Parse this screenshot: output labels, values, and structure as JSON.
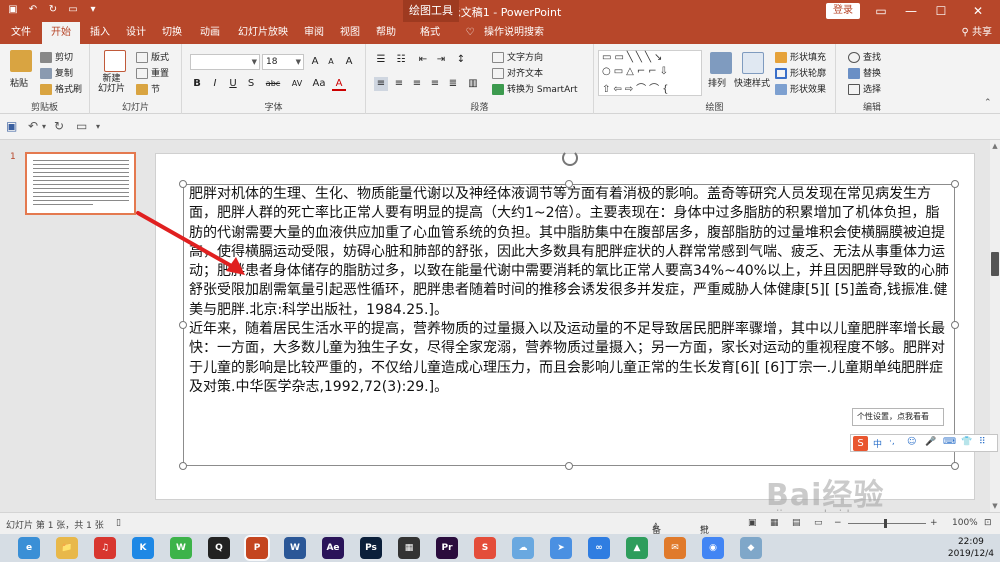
{
  "window": {
    "title": "演示文稿1 - PowerPoint",
    "contextual_tab_group": "绘图工具",
    "login_button": "登录",
    "controls": [
      "—",
      "☐",
      "✕"
    ]
  },
  "tabs": [
    "文件",
    "开始",
    "插入",
    "设计",
    "切换",
    "动画",
    "幻灯片放映",
    "审阅",
    "视图",
    "帮助",
    "格式"
  ],
  "tell_me": "操作说明搜索",
  "share": "共享",
  "ribbon": {
    "clipboard": {
      "label": "剪贴板",
      "paste": "粘贴",
      "cut": "剪切",
      "copy": "复制",
      "format_painter": "格式刷"
    },
    "slides": {
      "label": "幻灯片",
      "new_slide": "新建\n幻灯片",
      "layout": "版式",
      "reset": "重置",
      "section": "节"
    },
    "font": {
      "label": "字体",
      "font_name": "",
      "font_size": "18",
      "bold": "B",
      "italic": "I",
      "underline": "U",
      "strike": "S",
      "shadow": "abc",
      "spacing": "AV",
      "case": "Aa",
      "color": "A"
    },
    "paragraph": {
      "label": "段落",
      "text_direction": "文字方向",
      "align_text": "对齐文本",
      "smartart": "转换为 SmartArt"
    },
    "drawing": {
      "label": "绘图",
      "arrange": "排列",
      "quick_styles": "快速样式",
      "shape_fill": "形状填充",
      "shape_outline": "形状轮廓",
      "shape_effects": "形状效果"
    },
    "editing": {
      "label": "编辑",
      "find": "查找",
      "replace": "替换",
      "select": "选择"
    }
  },
  "thumbnail": {
    "number": "1"
  },
  "slide_text": "肥胖对机体的生理、生化、物质能量代谢以及神经体液调节等方面有着消极的影响。盖奇等研究人员发现在常见病发生方面，肥胖人群的死亡率比正常人要有明显的提高（大约1~2倍）。主要表现在：身体中过多脂肪的积累增加了机体负担，脂肪的代谢需要大量的血液供应加重了心血管系统的负担。其中脂肪集中在腹部居多，腹部脂肪的过量堆积会使横膈膜被迫提高，使得横膈运动受限，妨碍心脏和肺部的舒张，因此大多数具有肥胖症状的人群常常感到气喘、疲乏、无法从事重体力运动；肥胖患者身体储存的脂肪过多，以致在能量代谢中需要消耗的氧比正常人要高34%~40%以上，并且因肥胖导致的心肺舒张受限加剧需氧量引起恶性循环，肥胖患者随着时间的推移会诱发很多并发症，严重威胁人体健康[5][ [5]盖奇,钱振准.健美与肥胖.北京:科学出版社，1984.25.]。\n近年来，随着居民生活水平的提高，营养物质的过量摄入以及运动量的不足导致居民肥胖率骤增，其中以儿童肥胖率增长最快：一方面，大多数儿童为独生子女，尽得全家宠溺，营养物质过量摄入；另一方面，家长对运动的重视程度不够。肥胖对于儿童的影响是比较严重的，不仅给儿童造成心理压力，而且会影响儿童正常的生长发育[6][ [6]丁宗一.儿童期单纯肥胖症及对策.中华医学杂志,1992,72(3):29.]。",
  "ime": {
    "tooltip": "个性设置，点我看看",
    "logo": "S",
    "items": [
      "中",
      "·,",
      "☺",
      "🎤",
      "⌨",
      "👕",
      "⠿"
    ]
  },
  "watermark": {
    "brand": "Bai经验",
    "url": "jingyan.baidu.com"
  },
  "status": {
    "slide_info": "幻灯片 第 1 张，共 1 张",
    "notes": "备注",
    "comments": "批注",
    "zoom": "100%"
  },
  "taskbar": {
    "apps": [
      {
        "name": "browser-icon",
        "glyph": "e",
        "color": "#3a8fd6"
      },
      {
        "name": "file-explorer-icon",
        "glyph": "📁",
        "color": "#e8b84a"
      },
      {
        "name": "netease-music-icon",
        "glyph": "♫",
        "color": "#d8362f"
      },
      {
        "name": "kugou-icon",
        "glyph": "K",
        "color": "#1e88e5"
      },
      {
        "name": "wechat-icon",
        "glyph": "W",
        "color": "#3db34a"
      },
      {
        "name": "qq-icon",
        "glyph": "Q",
        "color": "#222222"
      },
      {
        "name": "powerpoint-icon",
        "glyph": "P",
        "color": "#c4451f"
      },
      {
        "name": "word-icon",
        "glyph": "W",
        "color": "#2b5797"
      },
      {
        "name": "after-effects-icon",
        "glyph": "Ae",
        "color": "#2a1459"
      },
      {
        "name": "photoshop-icon",
        "glyph": "Ps",
        "color": "#0b1f3a"
      },
      {
        "name": "video-editor-icon",
        "glyph": "▦",
        "color": "#333333"
      },
      {
        "name": "premiere-icon",
        "glyph": "Pr",
        "color": "#2a0c3d"
      },
      {
        "name": "wps-icon",
        "glyph": "S",
        "color": "#e44d3a"
      },
      {
        "name": "cloud-app-icon",
        "glyph": "☁",
        "color": "#69a8e0"
      },
      {
        "name": "arrow-app-icon",
        "glyph": "➤",
        "color": "#4a90e2"
      },
      {
        "name": "baidu-netdisk-icon",
        "glyph": "∞",
        "color": "#2f7de1"
      },
      {
        "name": "image-app-icon",
        "glyph": "▲",
        "color": "#2e9d5c"
      },
      {
        "name": "foxmail-icon",
        "glyph": "✉",
        "color": "#e07a2b"
      },
      {
        "name": "chrome-icon",
        "glyph": "◉",
        "color": "#4285f4"
      },
      {
        "name": "app-icon",
        "glyph": "◆",
        "color": "#7fa7c9"
      }
    ],
    "time": "22:09",
    "date": "2019/12/4"
  }
}
